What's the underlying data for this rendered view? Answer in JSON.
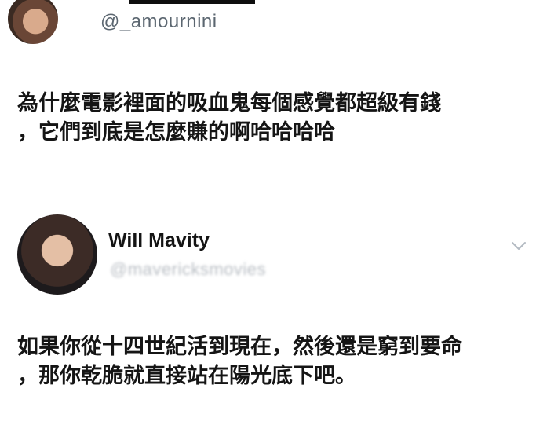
{
  "tweets": [
    {
      "handle": "@_amournini",
      "text_lines": [
        "為什麼電影裡面的吸血鬼每個感覺都超級有錢",
        "，它們到底是怎麼賺的啊哈哈哈哈"
      ]
    },
    {
      "display_name": "Will Mavity",
      "handle": "@mavericksmovies",
      "text_lines": [
        "如果你從十四世紀活到現在，然後還是窮到要命",
        "，那你乾脆就直接站在陽光底下吧。"
      ]
    }
  ],
  "icons": {
    "tweet1_avatar": "profile-photo",
    "tweet2_avatar": "profile-photo",
    "tweet2_menu": "chevron-down-icon"
  },
  "colors": {
    "text": "#151515",
    "handle_primary": "#5b6670",
    "handle_blurred": "#b9bec4",
    "chevron": "#b3bac2",
    "background": "#ffffff"
  }
}
